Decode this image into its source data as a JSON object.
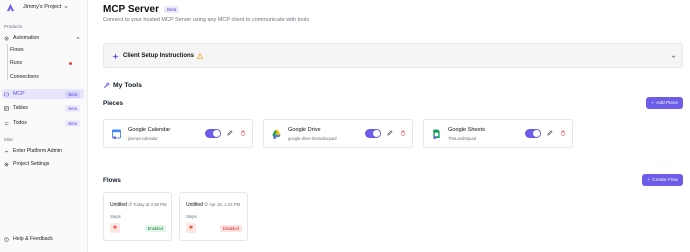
{
  "sidebar": {
    "project_name": "Jimmy's Project",
    "sections": {
      "products": "Products",
      "misc": "Misc"
    },
    "automation": {
      "label": "Automation",
      "children": [
        {
          "label": "Flows"
        },
        {
          "label": "Runs"
        },
        {
          "label": "Connections"
        }
      ]
    },
    "items": [
      {
        "label": "MCP",
        "badge": "Beta"
      },
      {
        "label": "Tables",
        "badge": "Beta"
      },
      {
        "label": "Todos",
        "badge": "Beta"
      }
    ],
    "misc_items": [
      {
        "label": "Enter Platform Admin"
      },
      {
        "label": "Project Settings"
      }
    ],
    "help": "Help & Feedback",
    "colors": {
      "accent": "#6d5ce7",
      "active_bg": "#e8e6fb",
      "run_dot": "#ef4444"
    }
  },
  "header": {
    "title": "MCP Server",
    "badge": "Beta",
    "subtitle": "Connect to your hosted MCP Server using any MCP client to communicate with tools"
  },
  "setup": {
    "title": "Client Setup Instructions",
    "warning_icon": "warning-icon"
  },
  "my_tools": {
    "title": "My Tools"
  },
  "pieces": {
    "title": "Pieces",
    "add_label": "Add Piece",
    "items": [
      {
        "name": "Google Calendar",
        "account": "jimmys-calendar",
        "icon": "google-calendar-icon",
        "enabled": true
      },
      {
        "name": "Google Drive",
        "account": "google-drive-thelandsquad",
        "icon": "google-drive-icon",
        "enabled": true
      },
      {
        "name": "Google Sheets",
        "account": "TheLandSquad",
        "icon": "google-sheets-icon",
        "enabled": true
      }
    ]
  },
  "flows": {
    "title": "Flows",
    "create_label": "Create Flow",
    "steps_label": "Steps",
    "items": [
      {
        "name": "Untitled",
        "time": "Today at 3:38 PM",
        "status": "Enabled"
      },
      {
        "name": "Untitled",
        "time": "Apr 16, 1:23 PM",
        "status": "Disabled"
      }
    ]
  }
}
